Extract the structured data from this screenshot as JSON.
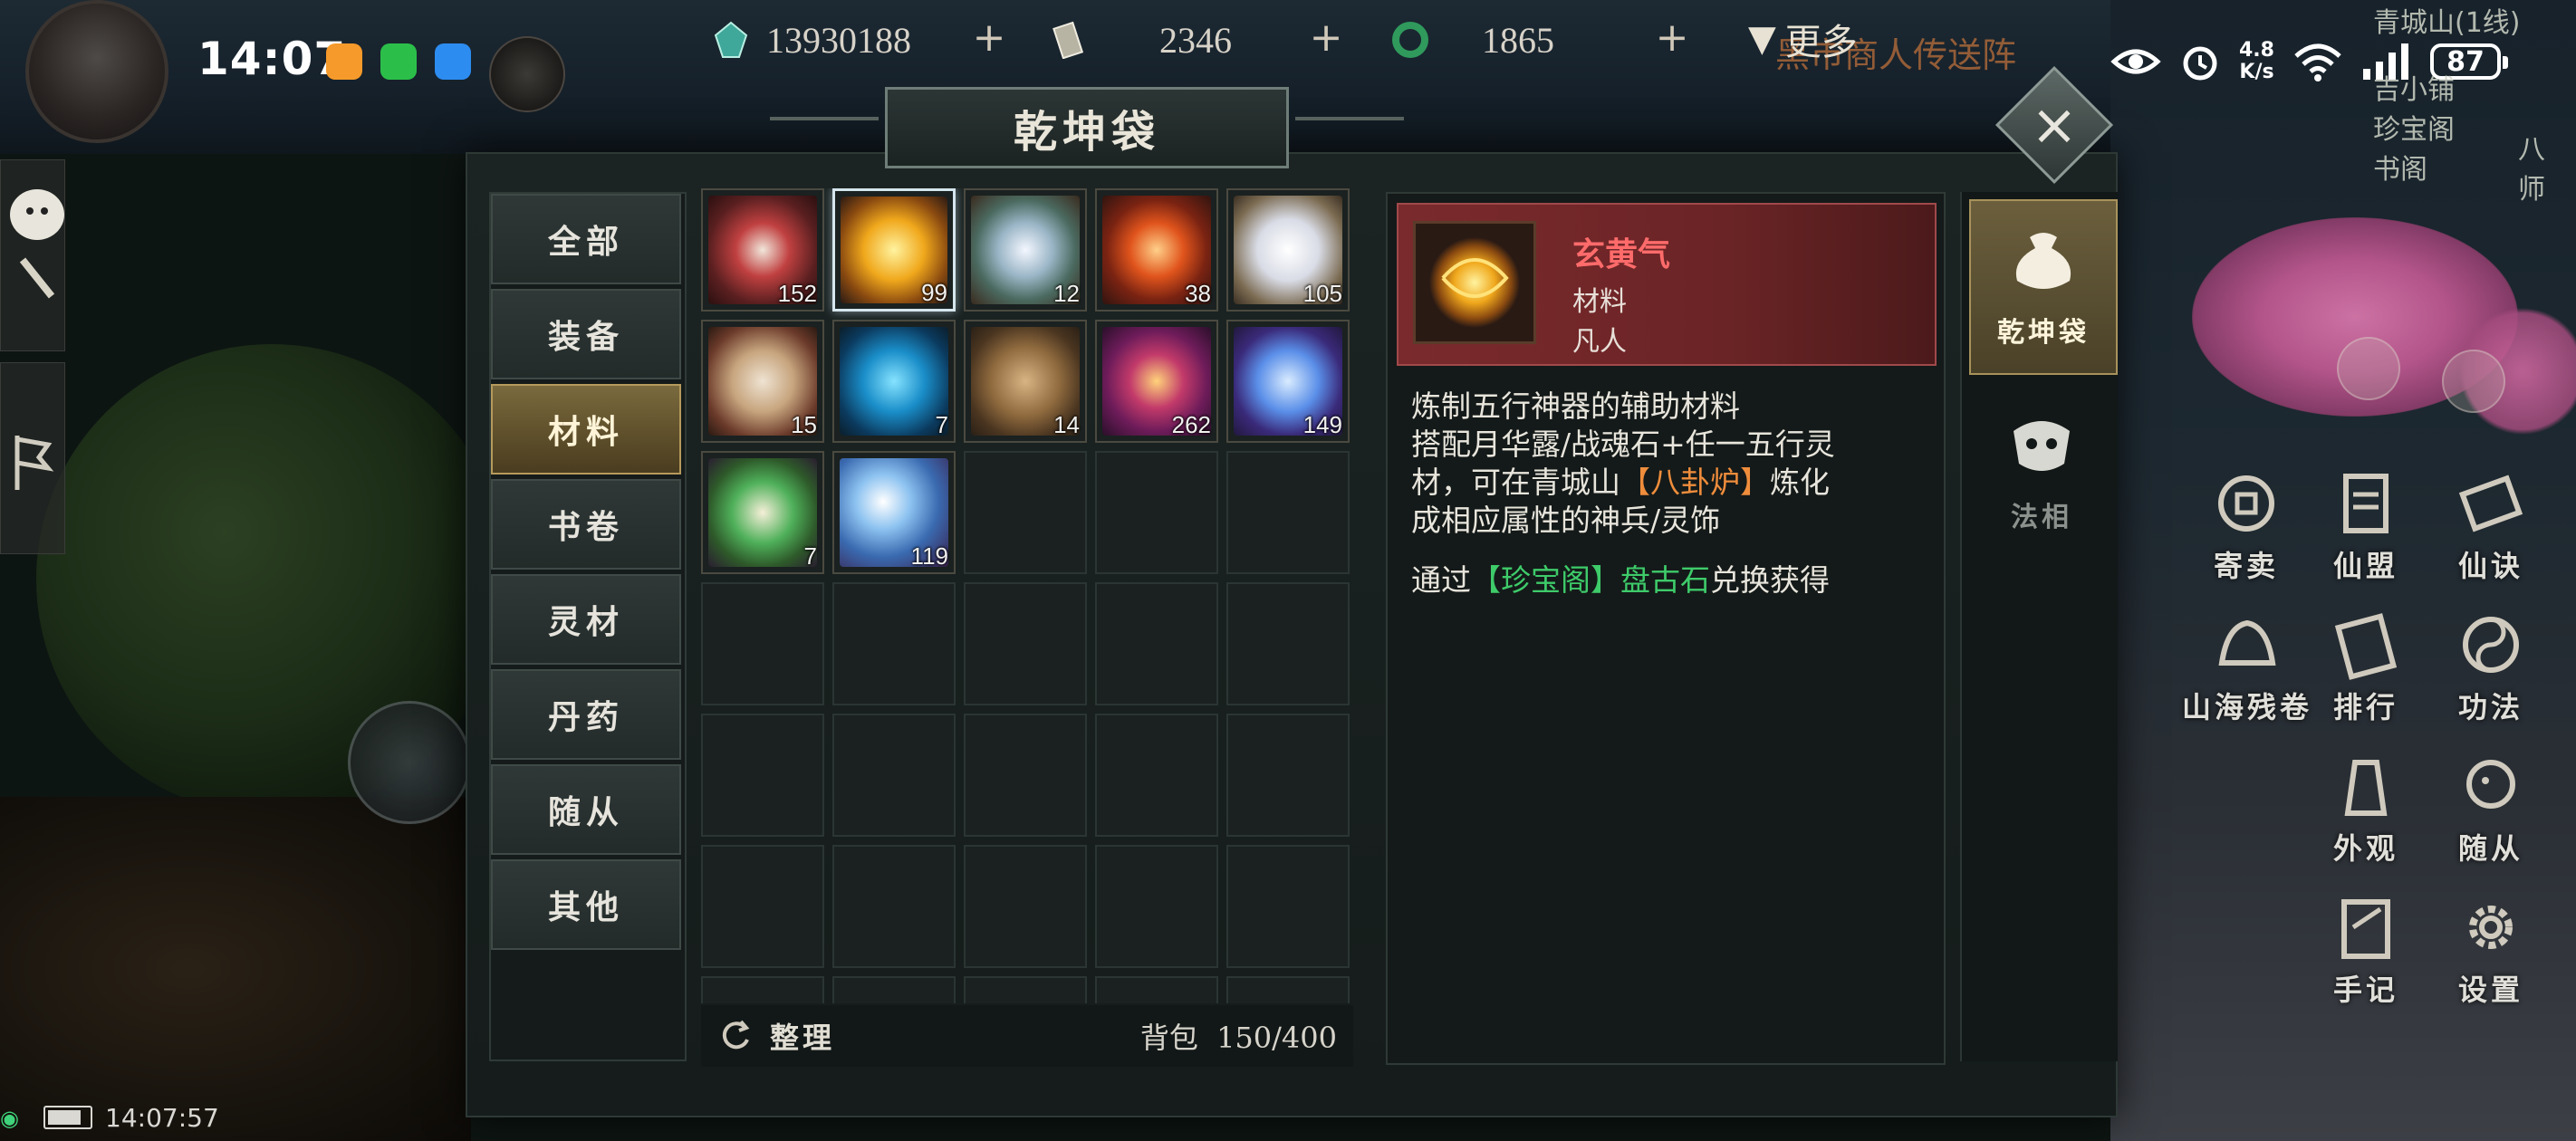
{
  "status_bar": {
    "time": "14:07",
    "net_speed_value": "4.8",
    "net_speed_unit": "K/s",
    "battery": "87"
  },
  "currency": [
    {
      "name": "jade-gem",
      "value": "13930188",
      "color": "#3fa89a"
    },
    {
      "name": "scroll-currency",
      "value": "2346",
      "color": "#b8b4a4"
    },
    {
      "name": "jade-ring",
      "value": "1865",
      "color": "#2f9a5c"
    }
  ],
  "header": {
    "more_label": "更多",
    "teleport_text": "黑市商人传送阵",
    "location_line1": "青城山(1线)",
    "location_line2": "吉小铺",
    "location_line3": "珍宝阁",
    "location_line4": "书阁",
    "location_npc": "八师"
  },
  "panel": {
    "title": "乾坤袋",
    "tabs": [
      {
        "label": "全部",
        "active": false
      },
      {
        "label": "装备",
        "active": false
      },
      {
        "label": "材料",
        "active": true
      },
      {
        "label": "书卷",
        "active": false
      },
      {
        "label": "灵材",
        "active": false
      },
      {
        "label": "丹药",
        "active": false
      },
      {
        "label": "随从",
        "active": false
      },
      {
        "label": "其他",
        "active": false
      }
    ],
    "items": [
      {
        "icon": "red-scroll-icon",
        "count": "152"
      },
      {
        "icon": "golden-qi-orb-icon",
        "count": "99",
        "selected": true
      },
      {
        "icon": "silver-swirl-orb-icon",
        "count": "12"
      },
      {
        "icon": "red-flame-orb-icon",
        "count": "38"
      },
      {
        "icon": "open-book-icon",
        "count": "105"
      },
      {
        "icon": "rolled-scroll-icon",
        "count": "15"
      },
      {
        "icon": "blue-wind-icon",
        "count": "7"
      },
      {
        "icon": "ore-stone-icon",
        "count": "14"
      },
      {
        "icon": "purple-ring-icon",
        "count": "262"
      },
      {
        "icon": "lotus-icon",
        "count": "149"
      },
      {
        "icon": "green-scroll-icon",
        "count": "7"
      },
      {
        "icon": "blue-pearl-icon",
        "count": "119"
      }
    ],
    "sort_label": "整理",
    "bag_label": "背包",
    "bag_value": "150/400"
  },
  "detail": {
    "name": "玄黄气",
    "type": "材料",
    "rank": "凡人",
    "desc_line1": "炼制五行神器的辅助材料",
    "desc_line2_a": "搭配月华露/战魂石+任一五行灵",
    "desc_line2_b": "材，可在青城山",
    "desc_line2_hl": "【八卦炉】",
    "desc_line2_c": "炼化",
    "desc_line3": "成相应属性的神兵/灵饰",
    "desc_line4_a": "通过",
    "desc_line4_hl": "【珍宝阁】盘古石",
    "desc_line4_b": "兑换获得"
  },
  "right_tabs": [
    {
      "label": "乾坤袋",
      "icon": "pouch-icon",
      "active": true
    },
    {
      "label": "法相",
      "icon": "mask-icon",
      "active": false
    }
  ],
  "game_menu": [
    {
      "label": "寄卖",
      "icon": "coin-icon"
    },
    {
      "label": "仙盟",
      "icon": "alliance-icon"
    },
    {
      "label": "仙诀",
      "icon": "scroll-skill-icon"
    },
    {
      "label": "山海残卷",
      "icon": "beast-icon"
    },
    {
      "label": "排行",
      "icon": "rank-icon"
    },
    {
      "label": "功法",
      "icon": "yin-yang-icon"
    },
    {
      "label": "外观",
      "icon": "appearance-icon"
    },
    {
      "label": "随从",
      "icon": "companion-icon"
    },
    {
      "label": "手记",
      "icon": "notebook-icon"
    },
    {
      "label": "设置",
      "icon": "gear-icon"
    }
  ],
  "bottom_status": {
    "time": "14:07:57"
  }
}
